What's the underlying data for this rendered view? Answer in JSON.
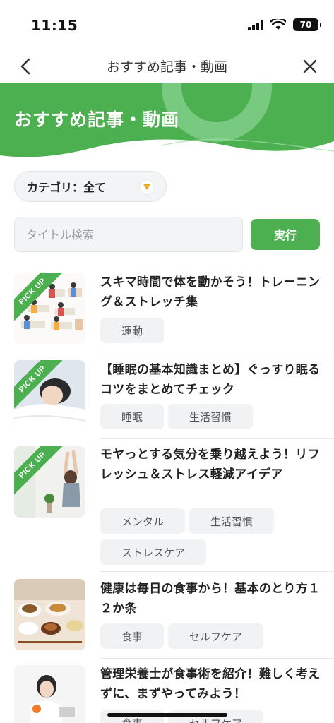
{
  "status_bar": {
    "time": "11:15",
    "battery": "70"
  },
  "nav": {
    "title": "おすすめ記事・動画"
  },
  "hero": {
    "title": "おすすめ記事・動画"
  },
  "filter": {
    "category_label": "カテゴリ：全て"
  },
  "search": {
    "placeholder": "タイトル検索",
    "button_label": "実行"
  },
  "pickup_label": "PICK UP",
  "colors": {
    "accent": "#4caf50",
    "accent_light": "#7fcf88"
  },
  "articles": [
    {
      "title": "スキマ時間で体を動かそう！トレーニング＆ストレッチ集",
      "tags": [
        "運動"
      ],
      "pickup": true,
      "image": "office-people-illustration"
    },
    {
      "title": "【睡眠の基本知識まとめ】ぐっすり眠るコツをまとめてチェック",
      "tags": [
        "睡眠",
        "生活習慣"
      ],
      "pickup": true,
      "image": "sleeping-woman-photo"
    },
    {
      "title": "モヤっとする気分を乗り越えよう！リフレッシュ＆ストレス軽減アイデア",
      "tags": [
        "メンタル",
        "生活習慣",
        "ストレスケア"
      ],
      "pickup": true,
      "image": "stretching-woman-photo"
    },
    {
      "title": "健康は毎日の食事から！基本のとり方１２か条",
      "tags": [
        "食事",
        "セルフケア"
      ],
      "pickup": false,
      "image": "japanese-meal-photo"
    },
    {
      "title": "管理栄養士が食事術を紹介！難しく考えずに、まずやってみよう！",
      "tags": [
        "食事",
        "セルフケア"
      ],
      "pickup": false,
      "image": "nutritionist-photo"
    }
  ]
}
